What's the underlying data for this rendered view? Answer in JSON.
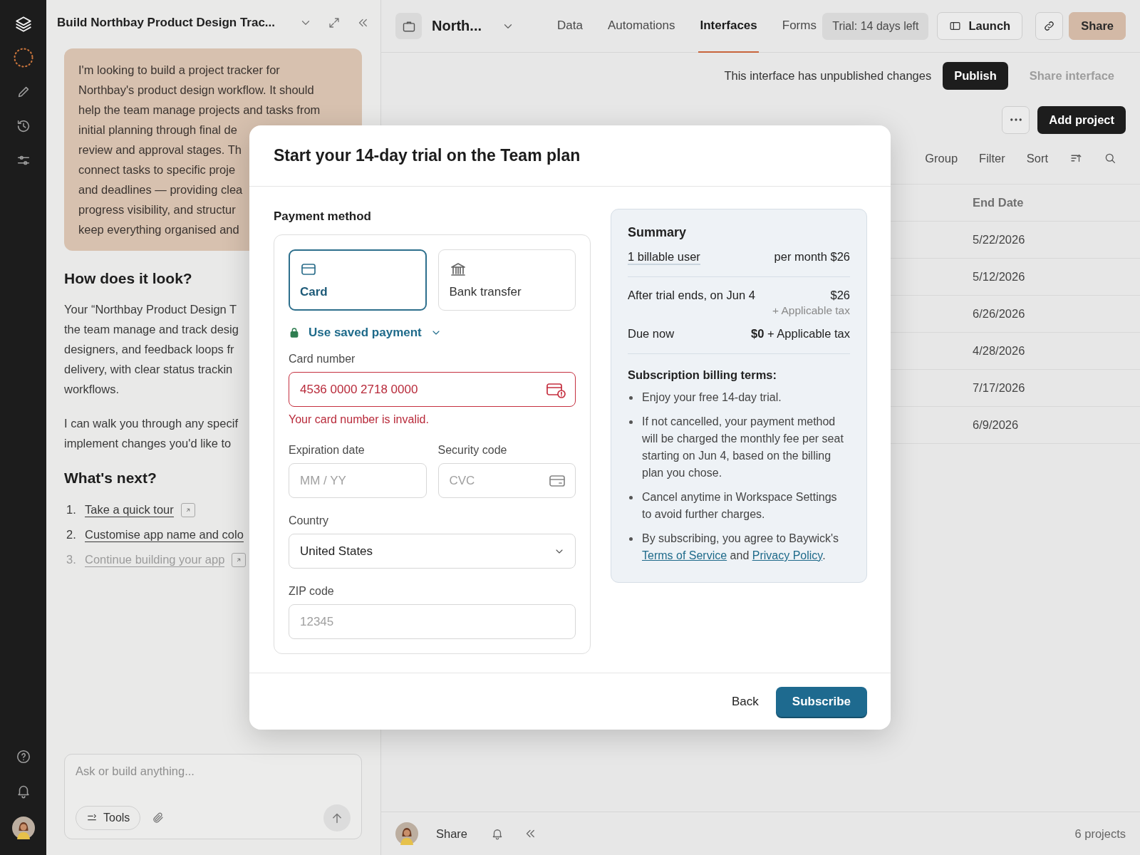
{
  "chat": {
    "title": "Build Northbay Product Design Trac...",
    "message_lines": [
      "I'm looking to build a project tracker for",
      "Northbay's product design workflow. It should",
      "help the team manage projects and tasks from",
      "initial planning through final de",
      "review and approval stages. Th",
      "connect tasks to specific proje",
      "and deadlines — providing clea",
      "progress visibility, and structur",
      "keep everything organised and"
    ],
    "look_heading": "How does it look?",
    "paragraph_1_lines": [
      "Your “Northbay Product Design T",
      "the team manage and track desig",
      "designers, and feedback loops fr",
      "delivery, with clear status trackin",
      "workflows."
    ],
    "paragraph_2_lines": [
      "I can walk you through any specif",
      "implement changes you'd like to"
    ],
    "next_heading": "What's next?",
    "next_steps": [
      {
        "number": "1.",
        "label": "Take a quick tour",
        "disabled": false,
        "external_icon": true
      },
      {
        "number": "2.",
        "label": "Customise app name and colo",
        "disabled": false,
        "external_icon": false
      },
      {
        "number": "3.",
        "label": "Continue building your app",
        "disabled": true,
        "external_icon": true
      }
    ],
    "input": {
      "placeholder": "Ask or build anything..."
    },
    "tools_button": "Tools"
  },
  "app_bar": {
    "name": "North...",
    "tabs": [
      {
        "label": "Data",
        "selected": false
      },
      {
        "label": "Automations",
        "selected": false
      },
      {
        "label": "Interfaces",
        "selected": true
      },
      {
        "label": "Forms",
        "selected": false
      }
    ],
    "trial": "Trial: 14 days left",
    "launch": "Launch",
    "share": "Share"
  },
  "publish_bar": {
    "message": "This interface has unpublished changes",
    "publish": "Publish",
    "share_interface": "Share interface"
  },
  "toolbar": {
    "add_project": "Add project",
    "view_controls": [
      "Group",
      "Filter",
      "Sort"
    ]
  },
  "table": {
    "columns": [
      "End Date"
    ],
    "rows": [
      [
        "5/22/2026"
      ],
      [
        "5/12/2026"
      ],
      [
        "6/26/2026"
      ],
      [
        "4/28/2026"
      ],
      [
        "7/17/2026"
      ],
      [
        "6/9/2026"
      ]
    ]
  },
  "footer": {
    "share": "Share",
    "count": "6 projects"
  },
  "modal": {
    "title": "Start your 14-day trial on the Team plan",
    "payment": {
      "heading": "Payment method",
      "methods": [
        {
          "kind": "card",
          "label": "Card",
          "selected": true
        },
        {
          "kind": "bank",
          "label": "Bank transfer",
          "selected": false
        }
      ],
      "saved_payment": "Use saved payment",
      "card_number": {
        "label": "Card number",
        "value": "4536 0000 2718 0000",
        "error": "Your card number is invalid."
      },
      "expiration": {
        "label": "Expiration date",
        "placeholder": "MM / YY"
      },
      "security_code": {
        "label": "Security code",
        "placeholder": "CVC"
      },
      "country": {
        "label": "Country",
        "value": "United States"
      },
      "zip": {
        "label": "ZIP code",
        "placeholder": "12345"
      }
    },
    "summary": {
      "heading": "Summary",
      "billable": "1 billable user",
      "per_month": "per month $26",
      "after_trial": "After trial ends, on Jun 4",
      "after_amount": "$26",
      "after_tax": "+ Applicable tax",
      "due_now": "Due now",
      "due_amount": "**$0** + Applicable tax",
      "terms_heading": "Subscription billing terms:",
      "terms": [
        {
          "segments": [
            {
              "kind": "text",
              "text": "Enjoy your free 14-day trial."
            }
          ]
        },
        {
          "segments": [
            {
              "kind": "text",
              "text": "If not cancelled, your payment method will be charged the monthly fee per seat starting on Jun 4, based on the billing plan you chose."
            }
          ]
        },
        {
          "segments": [
            {
              "kind": "text",
              "text": "Cancel anytime in Workspace Settings to avoid further charges."
            }
          ]
        },
        {
          "segments": [
            {
              "kind": "text",
              "text": "By subscribing, you agree to Baywick's "
            },
            {
              "kind": "link",
              "text": "Terms of Service"
            },
            {
              "kind": "text",
              "text": " and "
            },
            {
              "kind": "link",
              "text": "Privacy Policy"
            },
            {
              "kind": "text",
              "text": "."
            }
          ]
        }
      ]
    },
    "back": "Back",
    "subscribe": "Subscribe"
  }
}
